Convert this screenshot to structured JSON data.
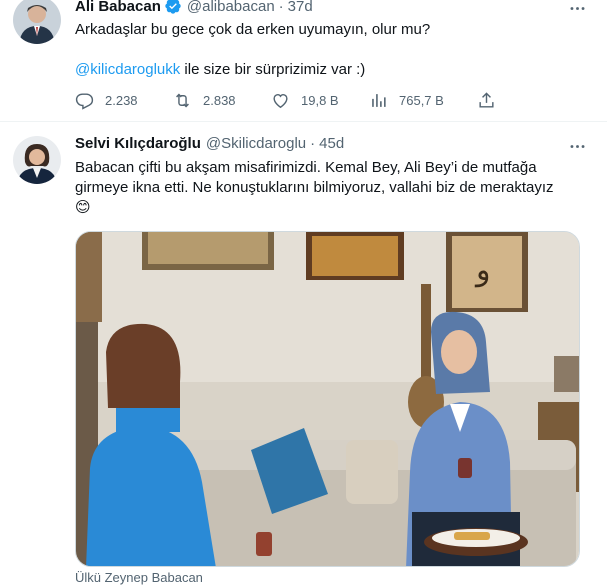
{
  "tweets": [
    {
      "author": {
        "name": "Ali Babacan",
        "handle": "@alibabacan",
        "time": "37d",
        "verified": true
      },
      "text_line1": "Arkadaşlar bu gece çok da erken uyumayın, olur mu?",
      "mention": "@kilicdaroglukk",
      "text_line2_rest": " ile size bir sürprizimiz var :)",
      "stats": {
        "replies": "2.238",
        "retweets": "2.838",
        "likes": "19,8 B",
        "views": "765,7 B"
      }
    },
    {
      "author": {
        "name": "Selvi Kılıçdaroğlu",
        "handle": "@Skilicdaroglu",
        "time": "45d"
      },
      "text": "Babacan çifti bu akşam misafirimizdi. Kemal Bey, Ali Bey’i de mutfağa girmeye ikna etti. Ne konuştuklarını bilmiyoruz, vallahi biz de meraktayız",
      "emoji": "😊",
      "photo_caption": "Ülkü Zeynep Babacan"
    }
  ],
  "colors": {
    "accent": "#1d9bf0",
    "muted": "#536471",
    "text": "#0f1419",
    "border": "#cfd9de"
  },
  "icons": [
    "verified-badge-icon",
    "more-icon",
    "reply-icon",
    "retweet-icon",
    "like-icon",
    "views-icon",
    "share-icon"
  ]
}
